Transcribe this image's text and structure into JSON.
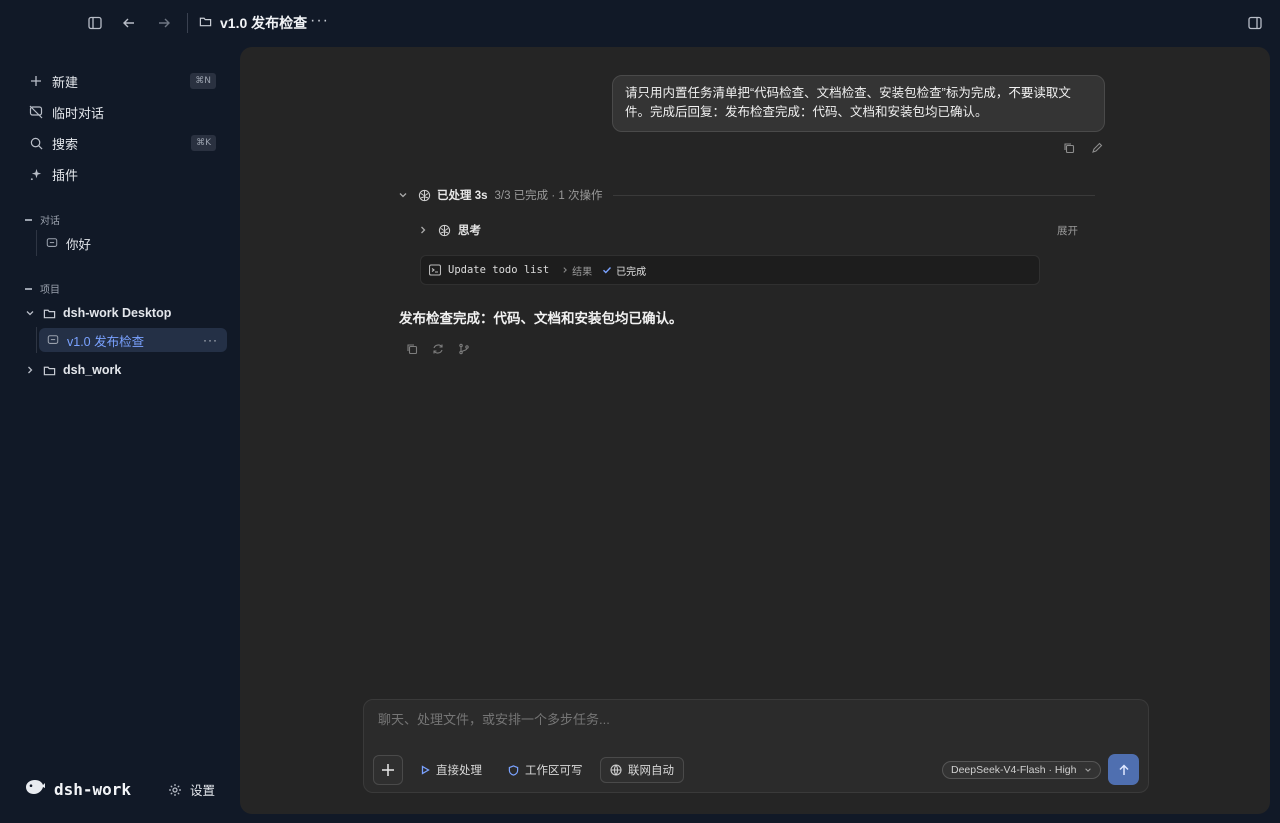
{
  "topbar": {
    "title": "v1.0 发布检查",
    "more": "···"
  },
  "sidebar": {
    "items": [
      {
        "label": "新建",
        "shortcut": "⌘N"
      },
      {
        "label": "临时对话"
      },
      {
        "label": "搜索",
        "shortcut": "⌘K"
      },
      {
        "label": "插件"
      }
    ],
    "section_conversations": "对话",
    "conversations": [
      {
        "label": "你好"
      }
    ],
    "section_projects": "项目",
    "projects": [
      {
        "label": "dsh-work Desktop",
        "expanded": true,
        "children": [
          {
            "label": "v1.0 发布检查",
            "active": true
          }
        ]
      },
      {
        "label": "dsh_work",
        "expanded": false
      }
    ],
    "brand": "dsh-work",
    "settings": "设置"
  },
  "chat": {
    "user_message": "请只用内置任务清单把“代码检查、文档检查、安装包检查”标为完成，不要读取文件。完成后回复：发布检查完成：代码、文档和安装包均已确认。",
    "processed_label": "已处理 3s",
    "processed_meta": "3/3 已完成 · 1 次操作",
    "thinking_label": "思考",
    "expand_label": "展开",
    "tool_cmd": "Update todo list",
    "tool_result_label": "结果",
    "tool_status": "已完成",
    "assistant_reply": "发布检查完成：代码、文档和安装包均已确认。"
  },
  "composer": {
    "placeholder": "聊天、处理文件，或安排一个多步任务...",
    "mode_direct": "直接处理",
    "mode_workspace": "工作区可写",
    "mode_web": "联网自动",
    "model": "DeepSeek-V4-Flash · High"
  },
  "colors": {
    "sidebar_bg": "#111927",
    "main_bg": "#252525",
    "accent": "#7aa2ff",
    "send_button": "#4f6fb0"
  }
}
